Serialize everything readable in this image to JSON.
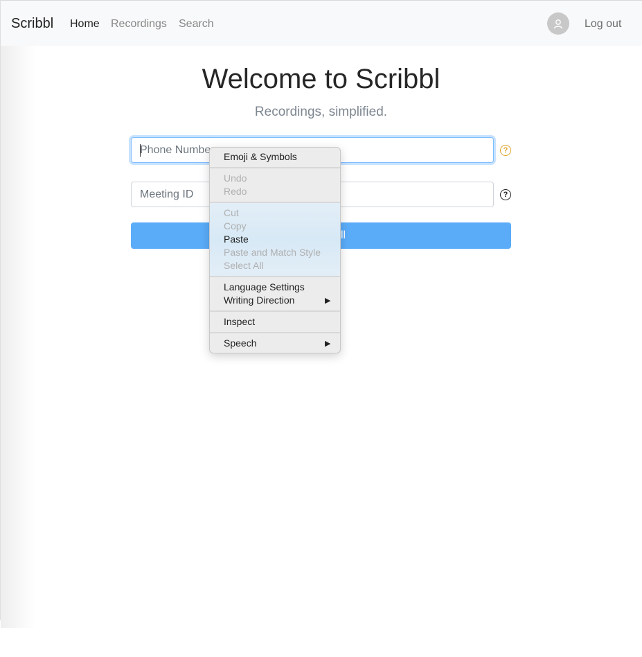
{
  "navbar": {
    "brand": "Scribbl",
    "links": [
      {
        "label": "Home",
        "active": true
      },
      {
        "label": "Recordings",
        "active": false
      },
      {
        "label": "Search",
        "active": false
      }
    ],
    "avatar_icon": "user-icon",
    "logout_label": "Log out"
  },
  "main": {
    "title": "Welcome to Scribbl",
    "subtitle": "Recordings, simplified.",
    "phone_field": {
      "placeholder": "Phone Number",
      "value": "",
      "help_icon": "question-circle-icon"
    },
    "meeting_field": {
      "placeholder": "Meeting ID",
      "value": "",
      "help_icon": "question-circle-icon"
    },
    "submit_label": "Go to Call"
  },
  "context_menu": {
    "items": [
      {
        "label": "Emoji & Symbols",
        "enabled": true
      },
      {
        "label": "Undo",
        "enabled": false
      },
      {
        "label": "Redo",
        "enabled": false
      },
      {
        "label": "Cut",
        "enabled": false
      },
      {
        "label": "Copy",
        "enabled": false
      },
      {
        "label": "Paste",
        "enabled": true
      },
      {
        "label": "Paste and Match Style",
        "enabled": false
      },
      {
        "label": "Select All",
        "enabled": false
      },
      {
        "label": "Language Settings",
        "enabled": true
      },
      {
        "label": "Writing Direction",
        "enabled": true,
        "submenu": true
      },
      {
        "label": "Inspect",
        "enabled": true
      },
      {
        "label": "Speech",
        "enabled": true,
        "submenu": true
      }
    ],
    "submenu_glyph": "▶"
  },
  "colors": {
    "primary_button": "#5aacf9",
    "warning_help": "#e0a22a"
  }
}
